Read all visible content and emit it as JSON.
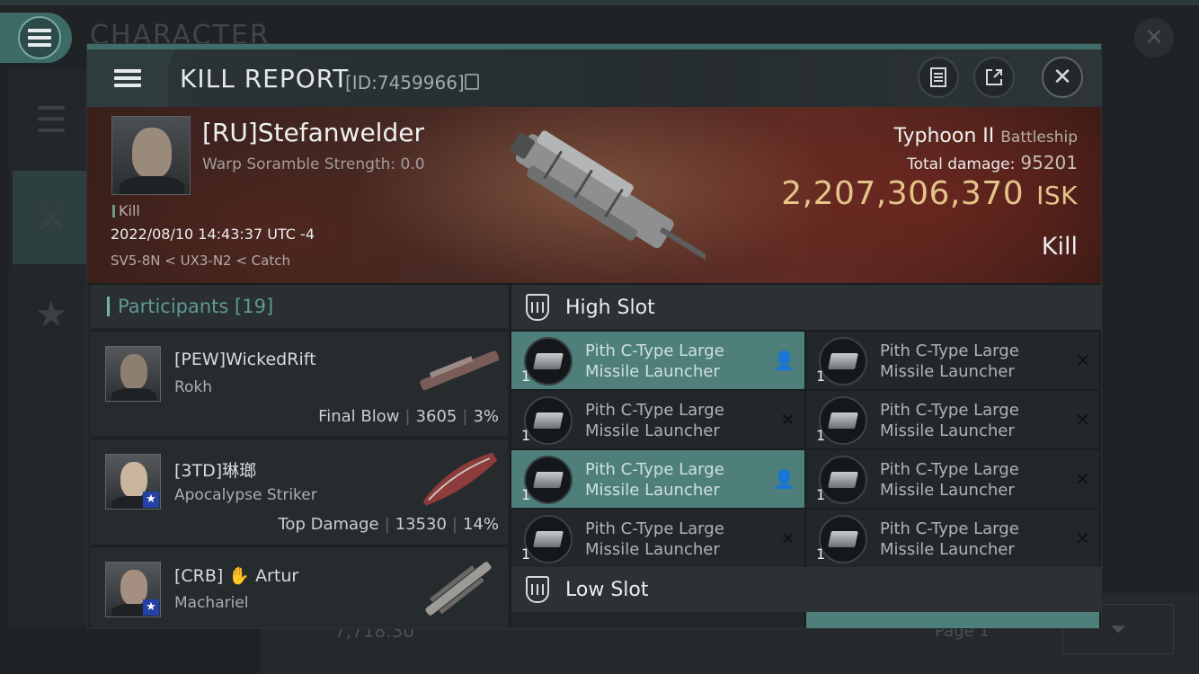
{
  "background": {
    "title": "CHARACTER",
    "bottom_value": "7,718.30",
    "page": "Page 1"
  },
  "header": {
    "title": "KILL REPORT",
    "id": "[ID:7459966]"
  },
  "victim": {
    "name": "[RU]Stefanwelder",
    "subtitle": "Warp Soramble Strength: 0.0",
    "tag": "Kill",
    "datetime": "2022/08/10 14:43:37 UTC -4",
    "location": "SV5-8N < UX3-N2 < Catch",
    "ship_name": "Typhoon II",
    "ship_class": "Battleship",
    "total_damage_label": "Total damage:",
    "total_damage": "95201",
    "isk_value": "2,207,306,370",
    "isk_unit": "ISK",
    "result": "Kill"
  },
  "participants": {
    "title": "Participants",
    "count": "[19]",
    "items": [
      {
        "name": "[PEW]WickedRift",
        "ship": "Rokh",
        "role": "Final Blow",
        "damage": "3605",
        "percent": "3%"
      },
      {
        "name": "[3TD]琳瑯",
        "ship": "Apocalypse Striker",
        "role": "Top Damage",
        "damage": "13530",
        "percent": "14%"
      },
      {
        "name": "[CRB] ✋ Artur",
        "ship": "Machariel",
        "role": "",
        "damage": "",
        "percent": ""
      }
    ]
  },
  "slots": {
    "high_label": "High Slot",
    "low_label": "Low Slot",
    "high_items": [
      {
        "qty": "1",
        "name_line1": "Pith C-Type Large",
        "name_line2": "Missile Launcher",
        "status": "dropped"
      },
      {
        "qty": "1",
        "name_line1": "Pith C-Type Large",
        "name_line2": "Missile Launcher",
        "status": "destroyed"
      },
      {
        "qty": "1",
        "name_line1": "Pith C-Type Large",
        "name_line2": "Missile Launcher",
        "status": "destroyed"
      },
      {
        "qty": "1",
        "name_line1": "Pith C-Type Large",
        "name_line2": "Missile Launcher",
        "status": "destroyed"
      },
      {
        "qty": "1",
        "name_line1": "Pith C-Type Large",
        "name_line2": "Missile Launcher",
        "status": "dropped"
      },
      {
        "qty": "1",
        "name_line1": "Pith C-Type Large",
        "name_line2": "Missile Launcher",
        "status": "destroyed"
      },
      {
        "qty": "1",
        "name_line1": "Pith C-Type Large",
        "name_line2": "Missile Launcher",
        "status": "destroyed"
      },
      {
        "qty": "1",
        "name_line1": "Pith C-Type Large",
        "name_line2": "Missile Launcher",
        "status": "destroyed"
      }
    ],
    "dropped_icon": "👤",
    "destroyed_icon": "✕"
  },
  "colors": {
    "accent": "#4e7f7a",
    "isk": "#e4c48a",
    "participants_title": "#5f9a93"
  }
}
